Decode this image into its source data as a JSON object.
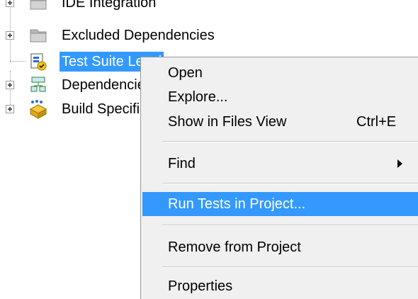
{
  "tree": {
    "items": [
      {
        "label": "IDE Integration",
        "icon": "folder-icon"
      },
      {
        "label": "Excluded Dependencies",
        "icon": "folder-icon"
      },
      {
        "label": "Test Suite Level",
        "icon": "test-suite-icon",
        "selected": true
      },
      {
        "label": "Dependencies",
        "icon": "dependencies-icon"
      },
      {
        "label": "Build Specifications",
        "icon": "build-spec-icon"
      }
    ]
  },
  "context_menu": {
    "items": [
      {
        "label": "Open"
      },
      {
        "label": "Explore..."
      },
      {
        "label": "Show in Files View",
        "shortcut": "Ctrl+E"
      },
      {
        "label": "Find",
        "submenu": true
      },
      {
        "label": "Run Tests in Project...",
        "highlighted": true
      },
      {
        "label": "Remove from Project"
      },
      {
        "label": "Properties"
      }
    ]
  },
  "colors": {
    "selection": "#3399ff",
    "menu_background": "#f0f0f0"
  }
}
